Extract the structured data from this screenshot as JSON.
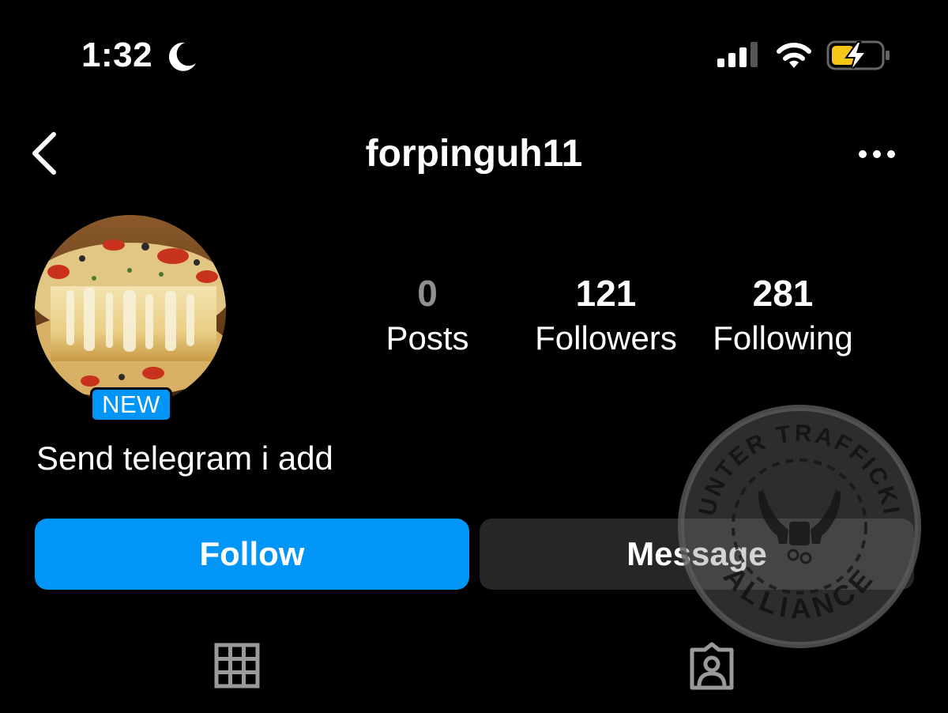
{
  "status_bar": {
    "time": "1:32",
    "moon_icon": "moon-icon",
    "signal_icon": "cellular-signal-icon",
    "wifi_icon": "wifi-icon",
    "battery_icon": "battery-charging-icon",
    "battery_color": "#f5c518"
  },
  "header": {
    "back_icon": "chevron-left-icon",
    "username": "forpinguh11",
    "more_icon": "ellipsis-icon"
  },
  "profile": {
    "avatar_description": "pizza-photo",
    "badge": "NEW",
    "bio": "Send telegram i add",
    "stats": [
      {
        "value": "0",
        "label": "Posts"
      },
      {
        "value": "121",
        "label": "Followers"
      },
      {
        "value": "281",
        "label": "Following"
      }
    ]
  },
  "actions": {
    "follow_label": "Follow",
    "message_label": "Message",
    "follow_color": "#0095f6",
    "message_color": "#262626"
  },
  "tabs": {
    "grid_icon": "grid-icon",
    "tagged_icon": "tagged-person-icon"
  },
  "watermark": {
    "text_top": "COUNTER TRAFFICKING",
    "text_bottom": "ALLIANCE"
  }
}
